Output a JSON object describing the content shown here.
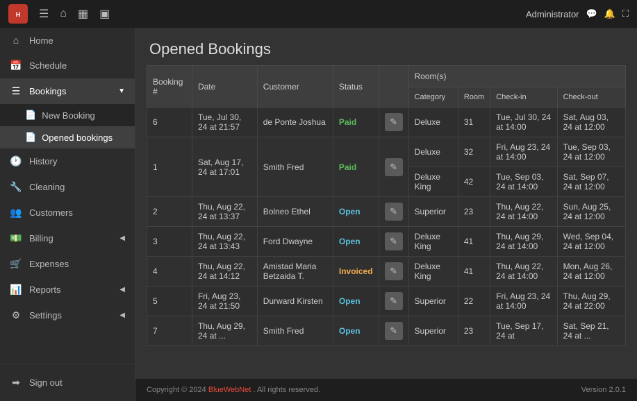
{
  "app": {
    "logo": "H",
    "title": "Opened Bookings",
    "user": "Administrator",
    "version": "Version 2.0.1",
    "copyright": "Copyright © 2024",
    "brand": "BlueWebNet",
    "rights": ". All rights reserved."
  },
  "topbar_icons": [
    "≡",
    "⌂",
    "▦",
    "▣"
  ],
  "topbar_right_icons": [
    "💬",
    "🔔",
    "⛶"
  ],
  "sidebar": {
    "items": [
      {
        "id": "home",
        "label": "Home",
        "icon": "⌂",
        "active": false
      },
      {
        "id": "schedule",
        "label": "Schedule",
        "icon": "📅",
        "active": false
      },
      {
        "id": "bookings",
        "label": "Bookings",
        "icon": "📋",
        "active": true,
        "has_arrow": true,
        "expanded": true
      },
      {
        "id": "new-booking",
        "label": "New Booking",
        "icon": "📄",
        "sub": true,
        "active": false
      },
      {
        "id": "opened-bookings",
        "label": "Opened bookings",
        "icon": "📄",
        "sub": true,
        "active": true
      },
      {
        "id": "history",
        "label": "History",
        "icon": "🕐",
        "active": false
      },
      {
        "id": "cleaning",
        "label": "Cleaning",
        "icon": "🔧",
        "active": false
      },
      {
        "id": "customers",
        "label": "Customers",
        "icon": "👥",
        "active": false
      },
      {
        "id": "billing",
        "label": "Billing",
        "icon": "💵",
        "active": false,
        "has_arrow": true
      },
      {
        "id": "expenses",
        "label": "Expenses",
        "icon": "🛒",
        "active": false
      },
      {
        "id": "reports",
        "label": "Reports",
        "icon": "📊",
        "active": false,
        "has_arrow": true
      },
      {
        "id": "settings",
        "label": "Settings",
        "icon": "⚙",
        "active": false,
        "has_arrow": true
      },
      {
        "id": "sign-out",
        "label": "Sign out",
        "icon": "➡",
        "active": false
      }
    ]
  },
  "table": {
    "headers": [
      "Booking #",
      "Date",
      "Customer",
      "Status",
      "",
      "Room(s)"
    ],
    "sub_headers": [
      "",
      "",
      "",
      "",
      "",
      "Category",
      "Room",
      "Check-in",
      "Check-out"
    ],
    "rows": [
      {
        "booking": "6",
        "date": "Tue, Jul 30, 24 at 21:57",
        "customer": "de Ponte Joshua",
        "status": "Paid",
        "status_class": "status-paid",
        "rooms": [
          {
            "category": "Deluxe",
            "room": "31",
            "checkin": "Tue, Jul 30, 24 at 14:00",
            "checkout": "Sat, Aug 03, 24 at 12:00"
          }
        ]
      },
      {
        "booking": "1",
        "date": "Sat, Aug 17, 24 at 17:01",
        "customer": "Smith Fred",
        "status": "Paid",
        "status_class": "status-paid",
        "rooms": [
          {
            "category": "Deluxe",
            "room": "32",
            "checkin": "Fri, Aug 23, 24 at 14:00",
            "checkout": "Tue, Sep 03, 24 at 12:00"
          },
          {
            "category": "Deluxe King",
            "room": "42",
            "checkin": "Tue, Sep 03, 24 at 14:00",
            "checkout": "Sat, Sep 07, 24 at 12:00"
          }
        ]
      },
      {
        "booking": "2",
        "date": "Thu, Aug 22, 24 at 13:37",
        "customer": "Bolneo Ethel",
        "status": "Open",
        "status_class": "status-open",
        "rooms": [
          {
            "category": "Superior",
            "room": "23",
            "checkin": "Thu, Aug 22, 24 at 14:00",
            "checkout": "Sun, Aug 25, 24 at 12:00"
          }
        ]
      },
      {
        "booking": "3",
        "date": "Thu, Aug 22, 24 at 13:43",
        "customer": "Ford Dwayne",
        "status": "Open",
        "status_class": "status-open",
        "rooms": [
          {
            "category": "Deluxe King",
            "room": "41",
            "checkin": "Thu, Aug 29, 24 at 14:00",
            "checkout": "Wed, Sep 04, 24 at 12:00"
          }
        ]
      },
      {
        "booking": "4",
        "date": "Thu, Aug 22, 24 at 14:12",
        "customer": "Amistad Maria Betzaida T.",
        "status": "Invoiced",
        "status_class": "status-invoiced",
        "rooms": [
          {
            "category": "Deluxe King",
            "room": "41",
            "checkin": "Thu, Aug 22, 24 at 14:00",
            "checkout": "Mon, Aug 26, 24 at 12:00"
          }
        ]
      },
      {
        "booking": "5",
        "date": "Fri, Aug 23, 24 at 21:50",
        "customer": "Durward Kirsten",
        "status": "Open",
        "status_class": "status-open",
        "rooms": [
          {
            "category": "Superior",
            "room": "22",
            "checkin": "Fri, Aug 23, 24 at 14:00",
            "checkout": "Thu, Aug 29, 24 at 22:00"
          }
        ]
      },
      {
        "booking": "7",
        "date": "Thu, Aug 29, 24 at ...",
        "customer": "Smith Fred",
        "status": "Open",
        "status_class": "status-open",
        "rooms": [
          {
            "category": "Superior",
            "room": "23",
            "checkin": "Tue, Sep 17, 24 at",
            "checkout": "Sat, Sep 21, 24 at ..."
          }
        ]
      }
    ]
  }
}
